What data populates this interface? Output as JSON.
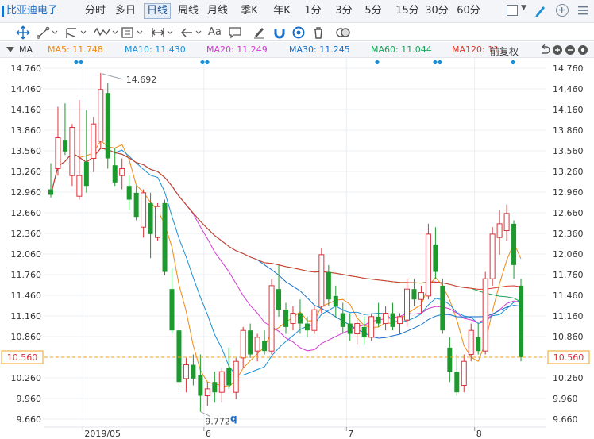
{
  "stock_name": "比亚迪电子",
  "period_tabs": [
    {
      "label": "分时",
      "active": false
    },
    {
      "label": "多日",
      "active": false
    },
    {
      "label": "日线",
      "active": true
    },
    {
      "label": "周线",
      "active": false
    },
    {
      "label": "月线",
      "active": false
    },
    {
      "label": "季K",
      "active": false
    },
    {
      "label": "年K",
      "active": false
    },
    {
      "label": "1分",
      "active": false
    },
    {
      "label": "3分",
      "active": false
    },
    {
      "label": "5分",
      "active": false
    },
    {
      "label": "15分",
      "active": false
    },
    {
      "label": "30分",
      "active": false
    },
    {
      "label": "60分",
      "active": false
    }
  ],
  "toolbar": {
    "text_tool_label": "Aa",
    "icons": [
      "move-icon",
      "line-icon",
      "pattern-icon",
      "wave-icon",
      "box-icon",
      "measure-icon",
      "arrow-icon",
      "text-icon",
      "comment-icon",
      "eraser-icon",
      "magnet-icon",
      "eye-icon",
      "trash-icon",
      "toggle-icon"
    ]
  },
  "ma_legend": {
    "prefix": "MA",
    "items": [
      {
        "label": "MA5: 11.748",
        "color": "#f08a12"
      },
      {
        "label": "MA10: 11.430",
        "color": "#1a8fd6"
      },
      {
        "label": "MA20: 11.249",
        "color": "#d23ad2"
      },
      {
        "label": "MA30: 11.245",
        "color": "#1570c8"
      },
      {
        "label": "MA60: 11.044",
        "color": "#19a35a"
      },
      {
        "label": "MA120: 11.",
        "color": "#e0392b"
      }
    ],
    "adjust_label": "前复权"
  },
  "chart_data": {
    "type": "candlestick",
    "price_ticks": [
      "14.760",
      "14.460",
      "14.160",
      "13.860",
      "13.560",
      "13.260",
      "12.960",
      "12.660",
      "12.360",
      "12.060",
      "11.760",
      "11.460",
      "11.160",
      "10.860",
      "10.560",
      "10.260",
      "9.960",
      "9.660"
    ],
    "ylim": [
      9.66,
      14.76
    ],
    "current_price": "10.560",
    "high_annotation": "14.692",
    "low_annotation": "9.772",
    "x_labels": [
      {
        "label": "2019/05",
        "index": 5
      },
      {
        "label": "6",
        "index": 22
      },
      {
        "label": "7",
        "index": 42
      },
      {
        "label": "8",
        "index": 60
      }
    ],
    "marker_label": "q",
    "candles": [
      [
        13.0,
        13.38,
        12.88,
        12.92
      ],
      [
        13.3,
        14.2,
        13.2,
        13.75
      ],
      [
        13.72,
        14.25,
        13.5,
        13.55
      ],
      [
        13.2,
        13.95,
        13.05,
        13.9
      ],
      [
        12.9,
        14.3,
        12.85,
        13.2
      ],
      [
        13.4,
        14.15,
        12.95,
        13.05
      ],
      [
        13.45,
        14.05,
        13.25,
        13.95
      ],
      [
        13.7,
        14.692,
        13.6,
        14.45
      ],
      [
        14.4,
        14.55,
        13.3,
        13.45
      ],
      [
        13.35,
        13.6,
        13.05,
        13.1
      ],
      [
        13.2,
        13.45,
        13.0,
        13.3
      ],
      [
        13.05,
        13.2,
        12.7,
        12.85
      ],
      [
        12.95,
        13.05,
        12.55,
        12.6
      ],
      [
        12.45,
        13.0,
        12.3,
        12.95
      ],
      [
        12.8,
        12.95,
        12.0,
        12.35
      ],
      [
        12.3,
        12.8,
        12.25,
        12.75
      ],
      [
        12.8,
        12.85,
        11.75,
        11.8
      ],
      [
        11.55,
        11.85,
        10.9,
        10.95
      ],
      [
        10.95,
        11.05,
        10.05,
        10.2
      ],
      [
        10.25,
        10.55,
        10.05,
        10.45
      ],
      [
        10.45,
        10.6,
        10.15,
        10.25
      ],
      [
        10.3,
        10.6,
        9.77,
        10.0
      ],
      [
        10.0,
        10.2,
        9.85,
        10.1
      ],
      [
        10.2,
        10.35,
        9.9,
        10.05
      ],
      [
        10.05,
        10.4,
        9.9,
        10.35
      ],
      [
        10.4,
        10.7,
        10.1,
        10.15
      ],
      [
        10.05,
        10.55,
        9.95,
        10.5
      ],
      [
        10.55,
        11.0,
        10.4,
        10.95
      ],
      [
        10.95,
        11.05,
        10.55,
        10.6
      ],
      [
        10.65,
        10.9,
        10.5,
        10.85
      ],
      [
        10.8,
        10.95,
        10.6,
        10.65
      ],
      [
        10.65,
        11.7,
        10.6,
        11.6
      ],
      [
        11.55,
        11.9,
        11.15,
        11.25
      ],
      [
        11.25,
        11.35,
        10.9,
        11.0
      ],
      [
        11.05,
        11.3,
        10.95,
        11.2
      ],
      [
        11.2,
        11.4,
        10.9,
        11.05
      ],
      [
        11.05,
        11.15,
        10.85,
        10.95
      ],
      [
        10.95,
        11.3,
        10.9,
        11.25
      ],
      [
        11.3,
        12.15,
        11.2,
        12.05
      ],
      [
        11.8,
        11.9,
        11.3,
        11.4
      ],
      [
        11.45,
        11.6,
        11.15,
        11.3
      ],
      [
        11.2,
        11.35,
        10.9,
        11.0
      ],
      [
        11.05,
        11.2,
        10.8,
        10.9
      ],
      [
        10.9,
        11.1,
        10.75,
        11.05
      ],
      [
        11.0,
        11.15,
        10.75,
        10.85
      ],
      [
        10.85,
        11.2,
        10.8,
        11.15
      ],
      [
        11.15,
        11.35,
        11.0,
        11.05
      ],
      [
        11.05,
        11.3,
        10.95,
        11.2
      ],
      [
        11.2,
        11.35,
        10.95,
        11.0
      ],
      [
        11.05,
        11.2,
        10.9,
        11.15
      ],
      [
        11.1,
        11.7,
        11.0,
        11.55
      ],
      [
        11.55,
        11.7,
        11.3,
        11.4
      ],
      [
        11.4,
        11.6,
        11.2,
        11.5
      ],
      [
        11.45,
        12.5,
        11.4,
        12.35
      ],
      [
        12.2,
        12.45,
        11.7,
        11.8
      ],
      [
        11.6,
        11.7,
        10.9,
        10.95
      ],
      [
        10.7,
        10.85,
        10.2,
        10.35
      ],
      [
        10.35,
        10.6,
        10.0,
        10.05
      ],
      [
        10.15,
        10.6,
        10.05,
        10.5
      ],
      [
        10.6,
        11.05,
        10.5,
        10.95
      ],
      [
        10.85,
        11.05,
        10.6,
        10.65
      ],
      [
        10.65,
        11.8,
        10.6,
        11.7
      ],
      [
        11.7,
        12.45,
        11.6,
        12.35
      ],
      [
        12.3,
        12.7,
        12.05,
        12.5
      ],
      [
        12.4,
        12.78,
        12.25,
        12.65
      ],
      [
        12.5,
        12.55,
        11.7,
        11.9
      ],
      [
        11.6,
        11.7,
        10.5,
        10.56
      ]
    ]
  }
}
